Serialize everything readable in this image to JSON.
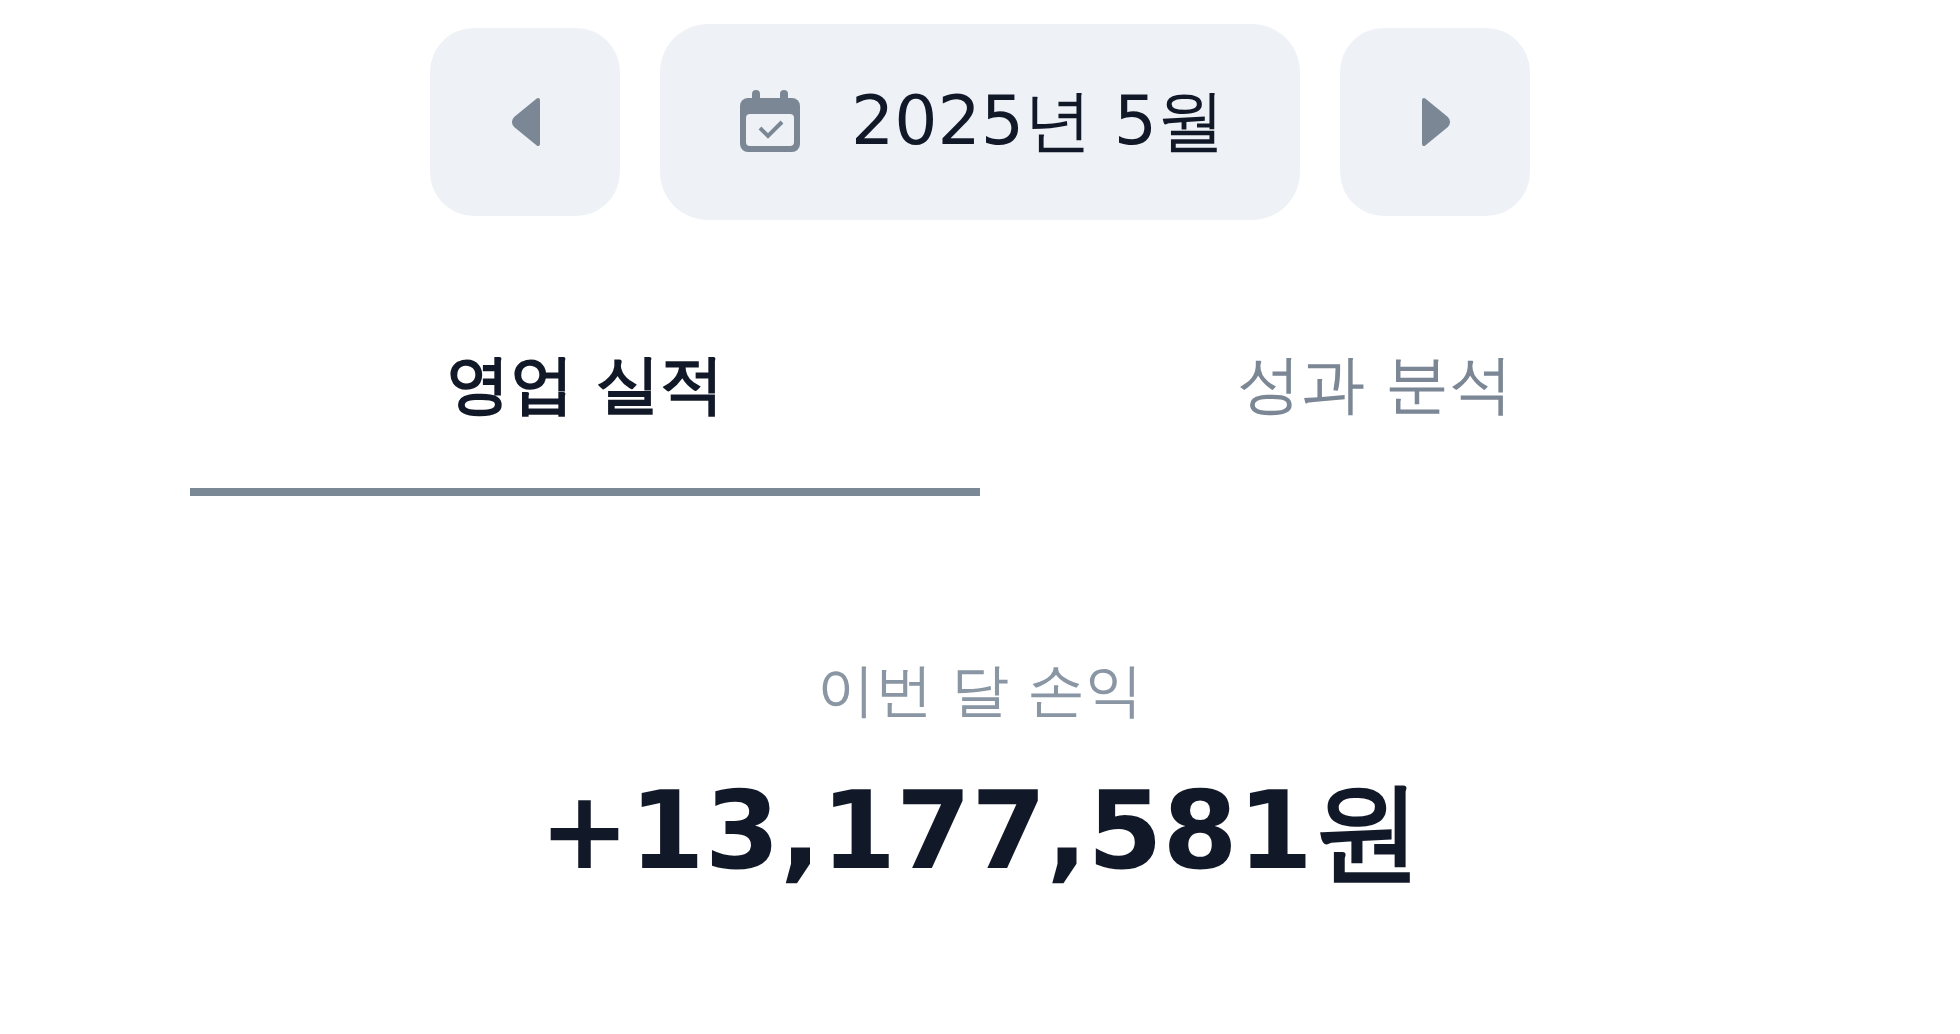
{
  "month_nav": {
    "label": "2025년 5월"
  },
  "tabs": [
    {
      "label": "영업 실적",
      "selected": true
    },
    {
      "label": "성과 분석",
      "selected": false
    }
  ],
  "summary": {
    "label": "이번 달 손익",
    "value": "+13,177,581원"
  }
}
